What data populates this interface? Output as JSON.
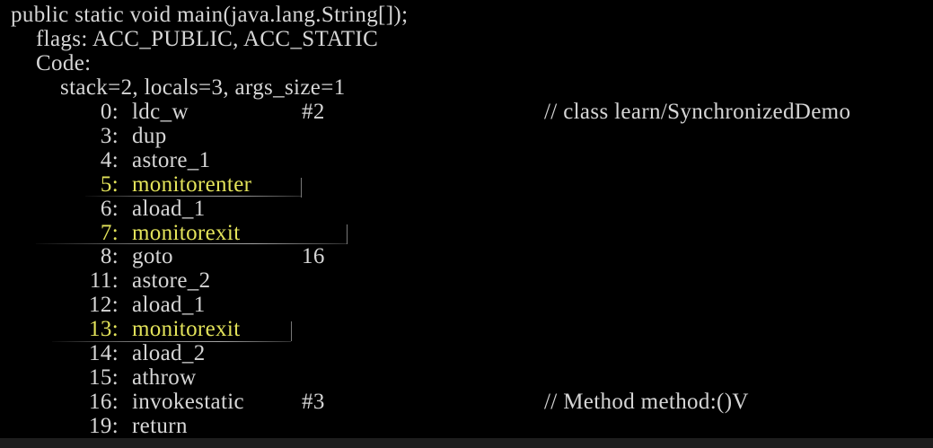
{
  "header": {
    "signature": "public static void main(java.lang.String[]);",
    "flags": "flags: ACC_PUBLIC, ACC_STATIC",
    "code_label": "Code:",
    "stack_info": "stack=2, locals=3, args_size=1"
  },
  "instructions": [
    {
      "offset": "0:",
      "opcode": "ldc_w",
      "operand": "#2",
      "comment": "// class learn/SynchronizedDemo"
    },
    {
      "offset": "3:",
      "opcode": "dup"
    },
    {
      "offset": "4:",
      "opcode": "astore_1"
    },
    {
      "offset": "5:",
      "opcode": "monitorenter",
      "highlighted": true
    },
    {
      "offset": "6:",
      "opcode": "aload_1"
    },
    {
      "offset": "7:",
      "opcode": "monitorexit",
      "highlighted": true
    },
    {
      "offset": "8:",
      "opcode": "goto",
      "operand": "16"
    },
    {
      "offset": "11:",
      "opcode": "astore_2"
    },
    {
      "offset": "12:",
      "opcode": "aload_1"
    },
    {
      "offset": "13:",
      "opcode": "monitorexit",
      "highlighted": true
    },
    {
      "offset": "14:",
      "opcode": "aload_2"
    },
    {
      "offset": "15:",
      "opcode": "athrow"
    },
    {
      "offset": "16:",
      "opcode": "invokestatic",
      "operand": "#3",
      "comment": "// Method method:()V"
    },
    {
      "offset": "19:",
      "opcode": "return"
    }
  ],
  "colors": {
    "background": "#000000",
    "text": "#d6d6d6",
    "highlight": "#e3e35a"
  }
}
